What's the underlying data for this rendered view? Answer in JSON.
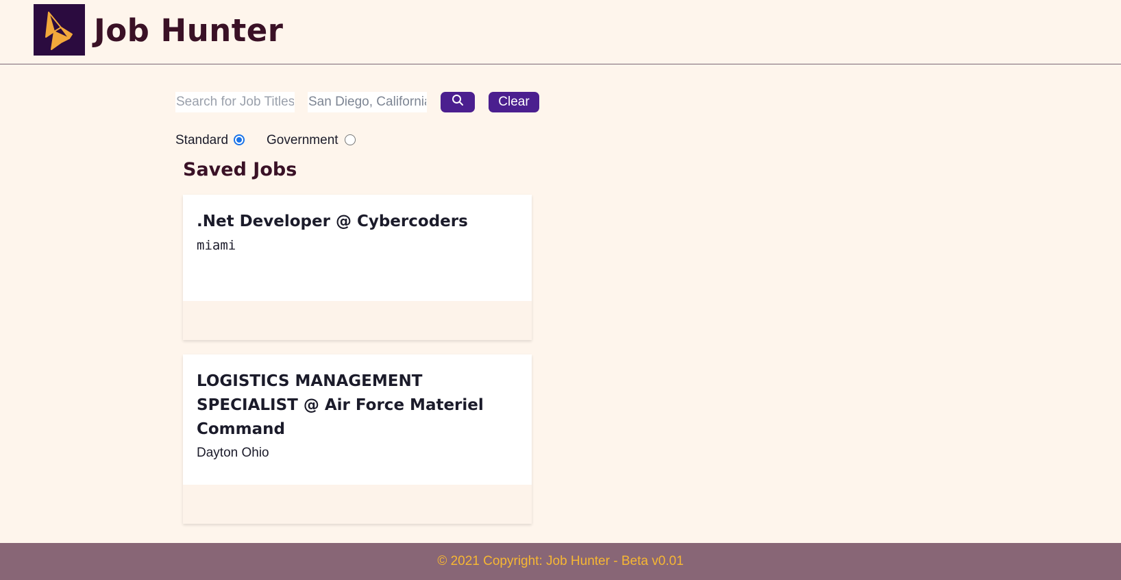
{
  "header": {
    "brand": "Job Hunter",
    "logo_icon": "origami-crane-icon"
  },
  "search": {
    "job_placeholder": "Search for Job Titles",
    "location_value": "San Diego, California",
    "search_icon": "search-icon",
    "clear_label": "Clear"
  },
  "job_type": {
    "options": [
      {
        "label": "Standard",
        "selected": true
      },
      {
        "label": "Government",
        "selected": false
      }
    ]
  },
  "saved": {
    "title": "Saved Jobs",
    "jobs": [
      {
        "title": ".Net Developer @ Cybercoders",
        "location": "miami"
      },
      {
        "title": "LOGISTICS MANAGEMENT SPECIALIST @ Air Force Materiel Command",
        "location": "Dayton Ohio"
      }
    ]
  },
  "footer": {
    "text": "© 2021 Copyright: Job Hunter - Beta v0.01"
  },
  "colors": {
    "background": "#fef5ec",
    "primary_button": "#4b1f8f",
    "brand_text": "#3a1126",
    "footer_bg": "#886676",
    "footer_text": "#f7b733",
    "logo_bg": "#2b0b3f"
  }
}
